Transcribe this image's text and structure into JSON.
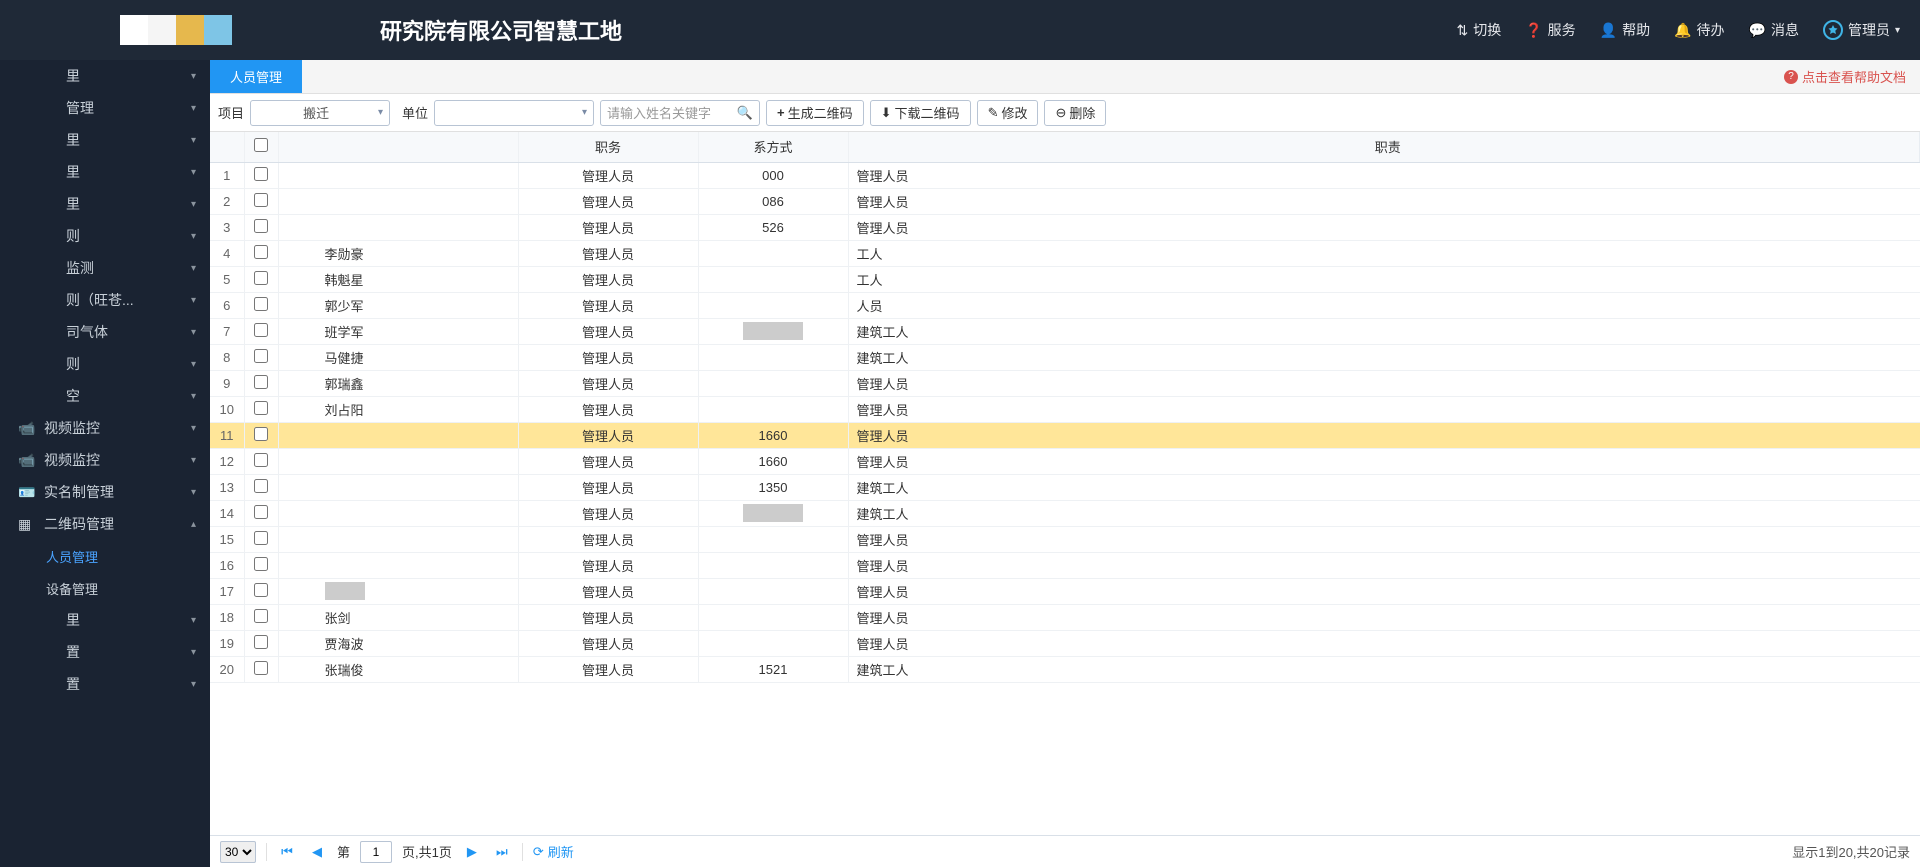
{
  "header": {
    "title": "研究院有限公司智慧工地",
    "switch": "切换",
    "service": "服务",
    "help": "帮助",
    "todo": "待办",
    "message": "消息",
    "admin": "管理员"
  },
  "sidebar": {
    "items": [
      {
        "label": "里",
        "chev": "▾"
      },
      {
        "label": "管理",
        "chev": "▾"
      },
      {
        "label": "里",
        "chev": "▾"
      },
      {
        "label": "里",
        "chev": "▾"
      },
      {
        "label": "里",
        "chev": "▾"
      },
      {
        "label": "则",
        "chev": "▾"
      },
      {
        "label": "监测",
        "chev": "▾"
      },
      {
        "label": "则（旺苍...",
        "chev": "▾"
      },
      {
        "label": "司气体",
        "chev": "▾"
      },
      {
        "label": "则",
        "chev": "▾"
      },
      {
        "label": "空",
        "chev": "▾"
      },
      {
        "label": "视频监控",
        "chev": "▾",
        "icon": "vid1"
      },
      {
        "label": "视频监控",
        "chev": "▾",
        "icon": "vid2"
      },
      {
        "label": "实名制管理",
        "chev": "▾",
        "icon": "id"
      },
      {
        "label": "二维码管理",
        "chev": "▴",
        "icon": "qr",
        "expanded": true,
        "children": [
          {
            "label": "人员管理",
            "active": true
          },
          {
            "label": "设备管理"
          }
        ]
      },
      {
        "label": "里",
        "chev": "▾"
      },
      {
        "label": "置",
        "chev": "▾"
      },
      {
        "label": "置",
        "chev": "▾"
      }
    ]
  },
  "tabs": {
    "active": "人员管理",
    "help_doc": "点击查看帮助文档"
  },
  "toolbar": {
    "project_label": "项目",
    "project_value": "搬迁",
    "unit_label": "单位",
    "unit_value": "",
    "search_placeholder": "请输入姓名关键字",
    "btn_qr_gen": "生成二维码",
    "btn_qr_dl": "下载二维码",
    "btn_edit": "修改",
    "btn_del": "删除"
  },
  "columns": {
    "job": "职务",
    "contact": "系方式",
    "duty": "职责"
  },
  "rows": [
    {
      "n": 1,
      "name": "",
      "job": "管理人员",
      "contact": "000",
      "duty": "管理人员"
    },
    {
      "n": 2,
      "name": "",
      "job": "管理人员",
      "contact": "086",
      "duty": "管理人员"
    },
    {
      "n": 3,
      "name": "",
      "job": "管理人员",
      "contact": "526",
      "duty": "管理人员"
    },
    {
      "n": 4,
      "name": "李勋豪",
      "job": "管理人员",
      "contact": "",
      "duty": "工人"
    },
    {
      "n": 5,
      "name": "韩魁星",
      "job": "管理人员",
      "contact": "",
      "duty": "工人"
    },
    {
      "n": 6,
      "name": "郭少军",
      "job": "管理人员",
      "contact": "",
      "duty": "人员"
    },
    {
      "n": 7,
      "name": "班学军",
      "job": "管理人员",
      "contact": "",
      "duty": "建筑工人",
      "mask_contact": true
    },
    {
      "n": 8,
      "name": "马健捷",
      "job": "管理人员",
      "contact": "",
      "duty": "建筑工人"
    },
    {
      "n": 9,
      "name": "郭瑞鑫",
      "job": "管理人员",
      "contact": "",
      "duty": "管理人员"
    },
    {
      "n": 10,
      "name": "刘占阳",
      "job": "管理人员",
      "contact": "",
      "duty": "管理人员"
    },
    {
      "n": 11,
      "name": "",
      "job": "管理人员",
      "contact": "1660",
      "duty": "管理人员",
      "highlight": true
    },
    {
      "n": 12,
      "name": "",
      "job": "管理人员",
      "contact": "1660",
      "duty": "管理人员"
    },
    {
      "n": 13,
      "name": "",
      "job": "管理人员",
      "contact": "1350",
      "duty": "建筑工人"
    },
    {
      "n": 14,
      "name": "",
      "job": "管理人员",
      "contact": "",
      "duty": "建筑工人",
      "mask_contact": true
    },
    {
      "n": 15,
      "name": "",
      "job": "管理人员",
      "contact": "",
      "duty": "管理人员"
    },
    {
      "n": 16,
      "name": "",
      "job": "管理人员",
      "contact": "",
      "duty": "管理人员"
    },
    {
      "n": 17,
      "name": "",
      "job": "管理人员",
      "contact": "",
      "duty": "管理人员",
      "mask_name": true
    },
    {
      "n": 18,
      "name": "张剑",
      "job": "管理人员",
      "contact": "",
      "duty": "管理人员"
    },
    {
      "n": 19,
      "name": "贾海波",
      "job": "管理人员",
      "contact": "",
      "duty": "管理人员"
    },
    {
      "n": 20,
      "name": "张瑞俊",
      "job": "管理人员",
      "contact": "1521",
      "duty": "建筑工人"
    }
  ],
  "pager": {
    "page_size": "30",
    "page_label_pre": "第",
    "page_current": "1",
    "page_label_post": "页,共1页",
    "refresh": "刷新",
    "info": "显示1到20,共20记录"
  }
}
